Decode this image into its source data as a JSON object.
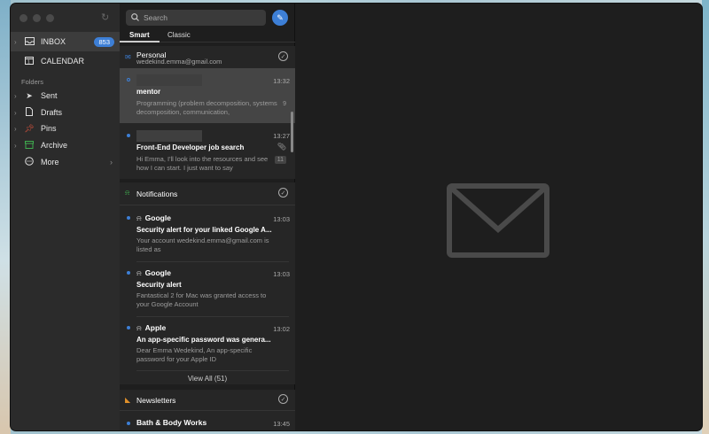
{
  "sidebar": {
    "items": [
      {
        "label": "INBOX",
        "icon": "inbox-icon",
        "badge": "853"
      },
      {
        "label": "CALENDAR",
        "icon": "calendar-icon"
      }
    ],
    "folders_label": "Folders",
    "folders": [
      {
        "label": "Sent",
        "icon": "send-icon"
      },
      {
        "label": "Drafts",
        "icon": "draft-icon"
      },
      {
        "label": "Pins",
        "icon": "pin-icon"
      },
      {
        "label": "Archive",
        "icon": "archive-icon"
      },
      {
        "label": "More",
        "icon": "more-icon"
      }
    ]
  },
  "search": {
    "placeholder": "Search"
  },
  "tabs": {
    "smart": "Smart",
    "classic": "Classic"
  },
  "sections": {
    "personal": {
      "title": "Personal",
      "subtitle": "wedekind.emma@gmail.com",
      "mails": [
        {
          "time": "13:32",
          "subject": "mentor",
          "preview": "Programming (problem decomposition, systems decomposition, communication,",
          "count": "9"
        },
        {
          "time": "13:27",
          "subject": "Front-End Developer job search",
          "preview": "Hi Emma, I'll look into the resources and see how I can start. I just want to say",
          "count": "11"
        }
      ]
    },
    "notifications": {
      "title": "Notifications",
      "mails": [
        {
          "from": "Google",
          "time": "13:03",
          "subject": "Security alert for your linked Google A...",
          "preview": "Your account wedekind.emma@gmail.com is listed as"
        },
        {
          "from": "Google",
          "time": "13:03",
          "subject": "Security alert",
          "preview": "Fantastical 2 for Mac was granted access to your Google Account"
        },
        {
          "from": "Apple",
          "time": "13:02",
          "subject": "An app-specific password was genera...",
          "preview": "Dear Emma Wedekind, An app-specific password for your Apple ID"
        }
      ],
      "view_all": "View All (51)"
    },
    "newsletters": {
      "title": "Newsletters",
      "mails": [
        {
          "from": "Bath & Body Works",
          "time": "13:45"
        }
      ]
    }
  },
  "colors": {
    "accent": "#3d7fd6",
    "background": "#1e1e1e",
    "sidebar": "#2b2b2b"
  }
}
